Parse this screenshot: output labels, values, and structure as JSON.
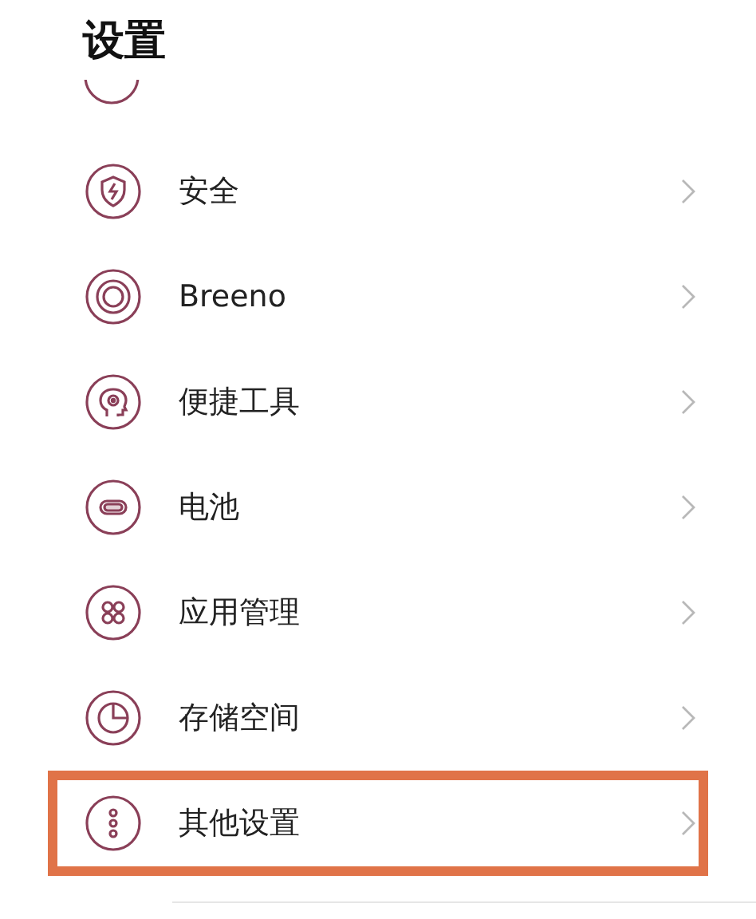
{
  "title": "设置",
  "items": [
    {
      "label": "安全",
      "highlighted": false
    },
    {
      "label": "Breeno",
      "highlighted": false
    },
    {
      "label": "便捷工具",
      "highlighted": false
    },
    {
      "label": "电池",
      "highlighted": false
    },
    {
      "label": "应用管理",
      "highlighted": false
    },
    {
      "label": "存储空间",
      "highlighted": false
    },
    {
      "label": "其他设置",
      "highlighted": true
    }
  ]
}
